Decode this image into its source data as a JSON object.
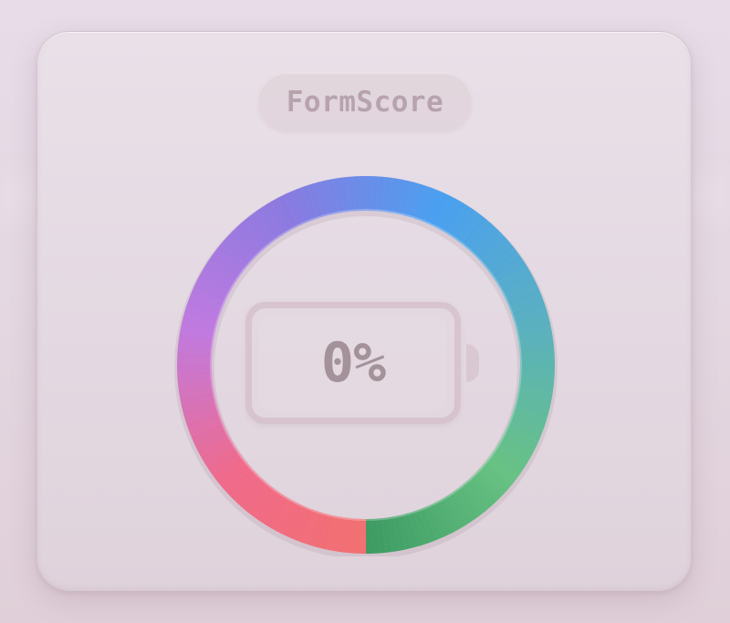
{
  "app": {
    "title": "FormScore"
  },
  "score": {
    "value": 0,
    "label": "0%"
  },
  "gauge": {
    "gradient_colors": [
      "#3d9b63",
      "#67c283",
      "#5ab0c0",
      "#4aa0f0",
      "#8a7ae0",
      "#c07ae0",
      "#f06a8a",
      "#f27070"
    ]
  },
  "icons": {
    "battery": "battery-icon"
  },
  "colors": {
    "background": "#e6dae5",
    "card": "#e6dce4",
    "title_text": "#b7a3ad",
    "percent_text": "#a39299",
    "battery_outline": "#d2bcc7"
  }
}
